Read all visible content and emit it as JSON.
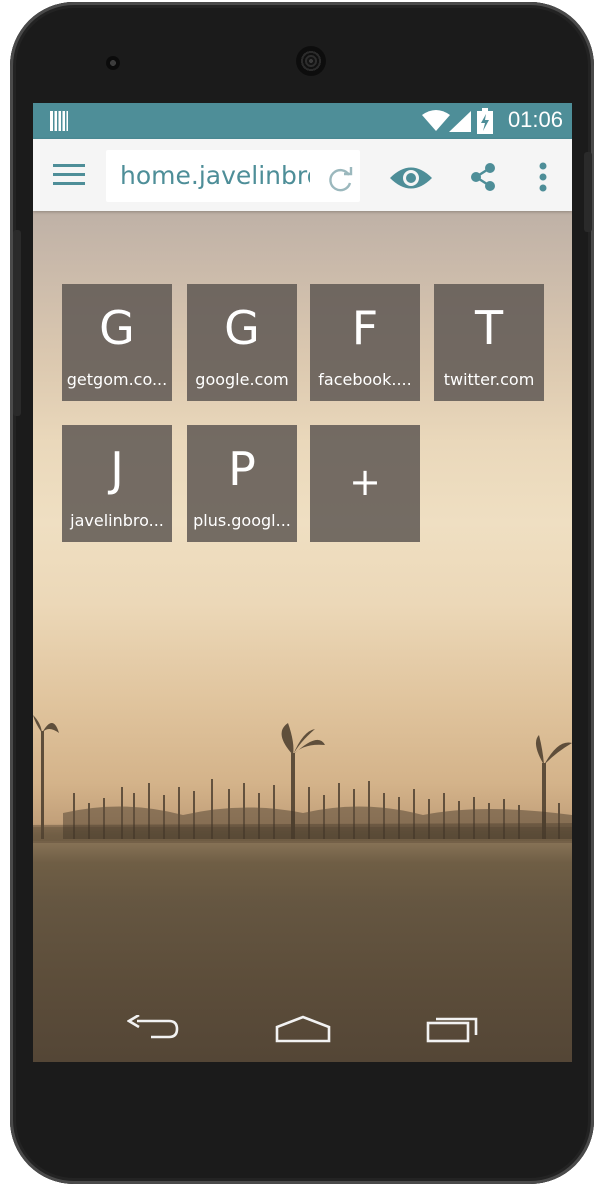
{
  "status_bar": {
    "time": "01:06",
    "icons": [
      "barcode-icon",
      "wifi-icon",
      "signal-icon",
      "battery-charging-icon"
    ]
  },
  "toolbar": {
    "url": "home.javelinbrowser.com",
    "icons": [
      "menu-icon",
      "refresh-icon",
      "eye-icon",
      "share-icon",
      "more-vert-icon"
    ]
  },
  "speed_dial": [
    {
      "letter": "G",
      "label": "getgom.co..."
    },
    {
      "letter": "G",
      "label": "google.com"
    },
    {
      "letter": "F",
      "label": "facebook...."
    },
    {
      "letter": "T",
      "label": "twitter.com"
    },
    {
      "letter": "J",
      "label": "javelinbro..."
    },
    {
      "letter": "P",
      "label": "plus.googl..."
    }
  ],
  "add_tile": {
    "symbol": "+"
  },
  "nav_bar": {
    "icons": [
      "back-icon",
      "home-icon",
      "recent-apps-icon"
    ]
  },
  "colors": {
    "accent": "#4e8e98",
    "tile": "#5f5854",
    "toolbar_bg": "#f5f5f5"
  }
}
